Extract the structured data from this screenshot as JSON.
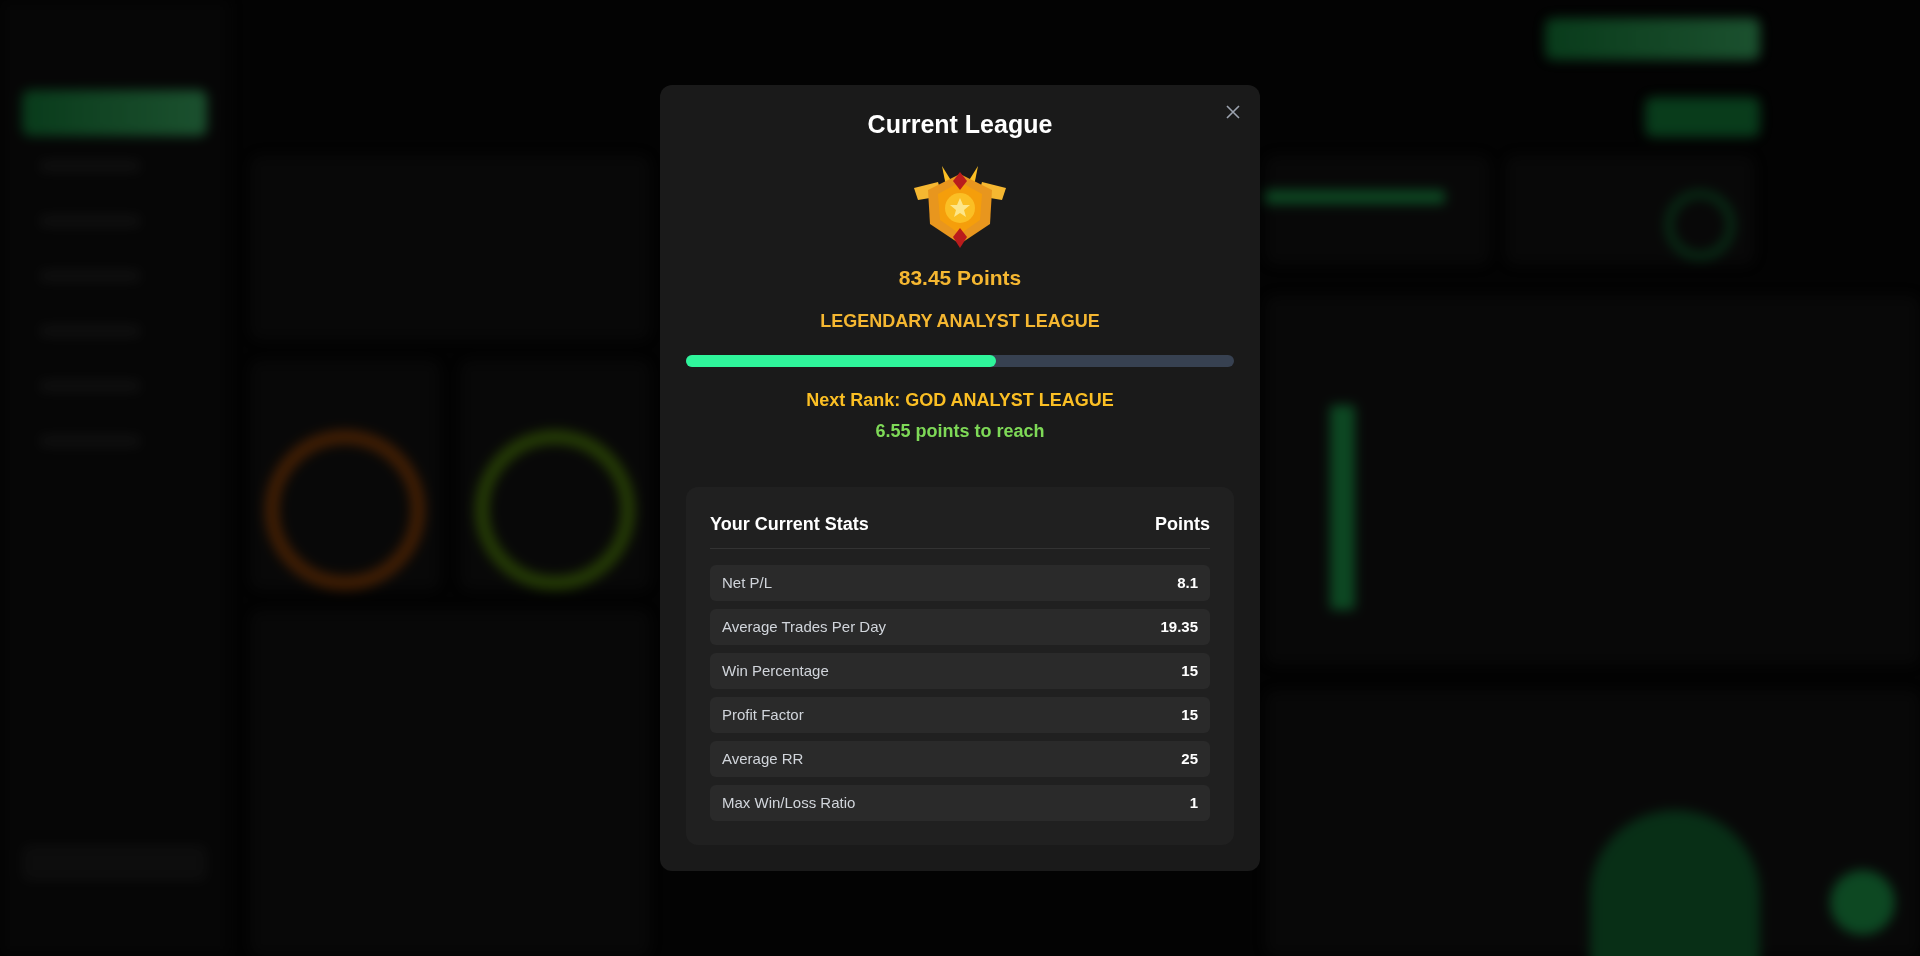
{
  "modal": {
    "title": "Current League",
    "points": "83.45 Points",
    "league": "LEGENDARY ANALYST LEAGUE",
    "progress": {
      "level": 0.565
    },
    "next_rank": "Next Rank: GOD ANALYST LEAGUE",
    "to_reach": "6.55 points to reach",
    "stats": {
      "columns": [
        "Your Current Stats",
        "Points"
      ],
      "rows": [
        {
          "name": "Net P/L",
          "points": "8.1"
        },
        {
          "name": "Average Trades Per Day",
          "points": "19.35"
        },
        {
          "name": "Win Percentage",
          "points": "15"
        },
        {
          "name": "Profit Factor",
          "points": "15"
        },
        {
          "name": "Average RR",
          "points": "25"
        },
        {
          "name": "Max Win/Loss Ratio",
          "points": "1"
        }
      ]
    }
  }
}
